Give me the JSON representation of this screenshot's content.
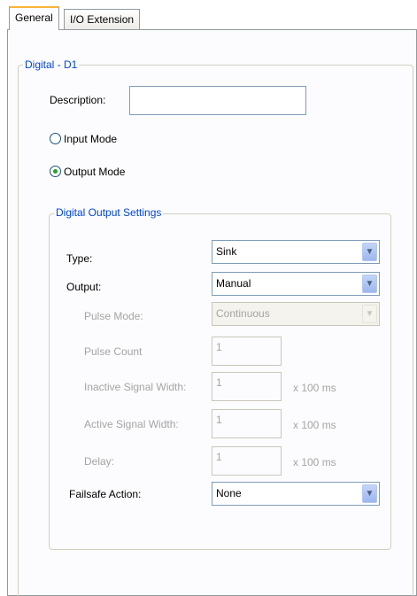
{
  "tabs": [
    {
      "label": "General"
    },
    {
      "label": "I/O Extension"
    }
  ],
  "digital_group": {
    "title": "Digital - D1",
    "description_label": "Description:",
    "description_value": "",
    "input_mode_label": "Input Mode",
    "output_mode_label": "Output Mode",
    "selected_mode": "Output Mode"
  },
  "output_settings": {
    "title": "Digital Output Settings",
    "type_label": "Type:",
    "type_value": "Sink",
    "output_label": "Output:",
    "output_value": "Manual",
    "pulse_mode_label": "Pulse Mode:",
    "pulse_mode_value": "Continuous",
    "pulse_count_label": "Pulse Count",
    "pulse_count_value": "1",
    "inactive_label": "Inactive Signal Width:",
    "inactive_value": "1",
    "active_label": "Active Signal Width:",
    "active_value": "1",
    "delay_label": "Delay:",
    "delay_value": "1",
    "unit": "x 100 ms",
    "failsafe_label": "Failsafe Action:",
    "failsafe_value": "None"
  }
}
